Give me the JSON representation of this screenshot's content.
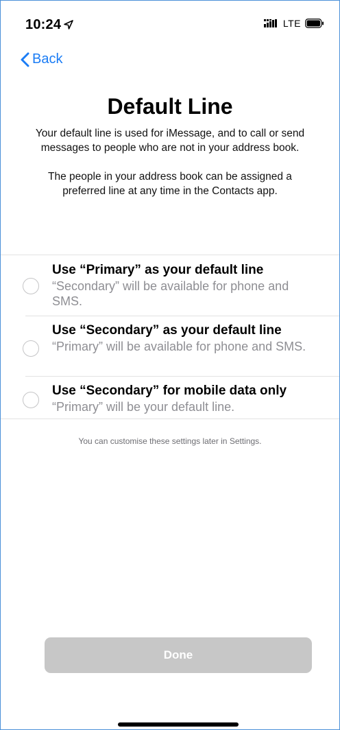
{
  "status_bar": {
    "time": "10:24",
    "network": "LTE"
  },
  "nav": {
    "back_label": "Back"
  },
  "page": {
    "title": "Default Line",
    "description_1": "Your default line is used for iMessage, and to call or send messages to people who are not in your address book.",
    "description_2": "The people in your address book can be assigned a preferred line at any time in the Contacts app."
  },
  "options": [
    {
      "title": "Use “Primary” as your default line",
      "subtitle": "“Secondary” will be available for phone and SMS.",
      "selected": false
    },
    {
      "title": "Use “Secondary” as your default line",
      "subtitle": "“Primary” will be available for phone and SMS.",
      "selected": false
    },
    {
      "title": "Use “Secondary” for mobile data only",
      "subtitle": "“Primary” will be your default line.",
      "selected": false
    }
  ],
  "footnote": "You can customise these settings later in Settings.",
  "done_button": {
    "label": "Done",
    "enabled": false
  },
  "colors": {
    "accent": "#1a7cf5",
    "disabled_button": "#c7c7c7",
    "secondary_text": "#8e8e93"
  }
}
